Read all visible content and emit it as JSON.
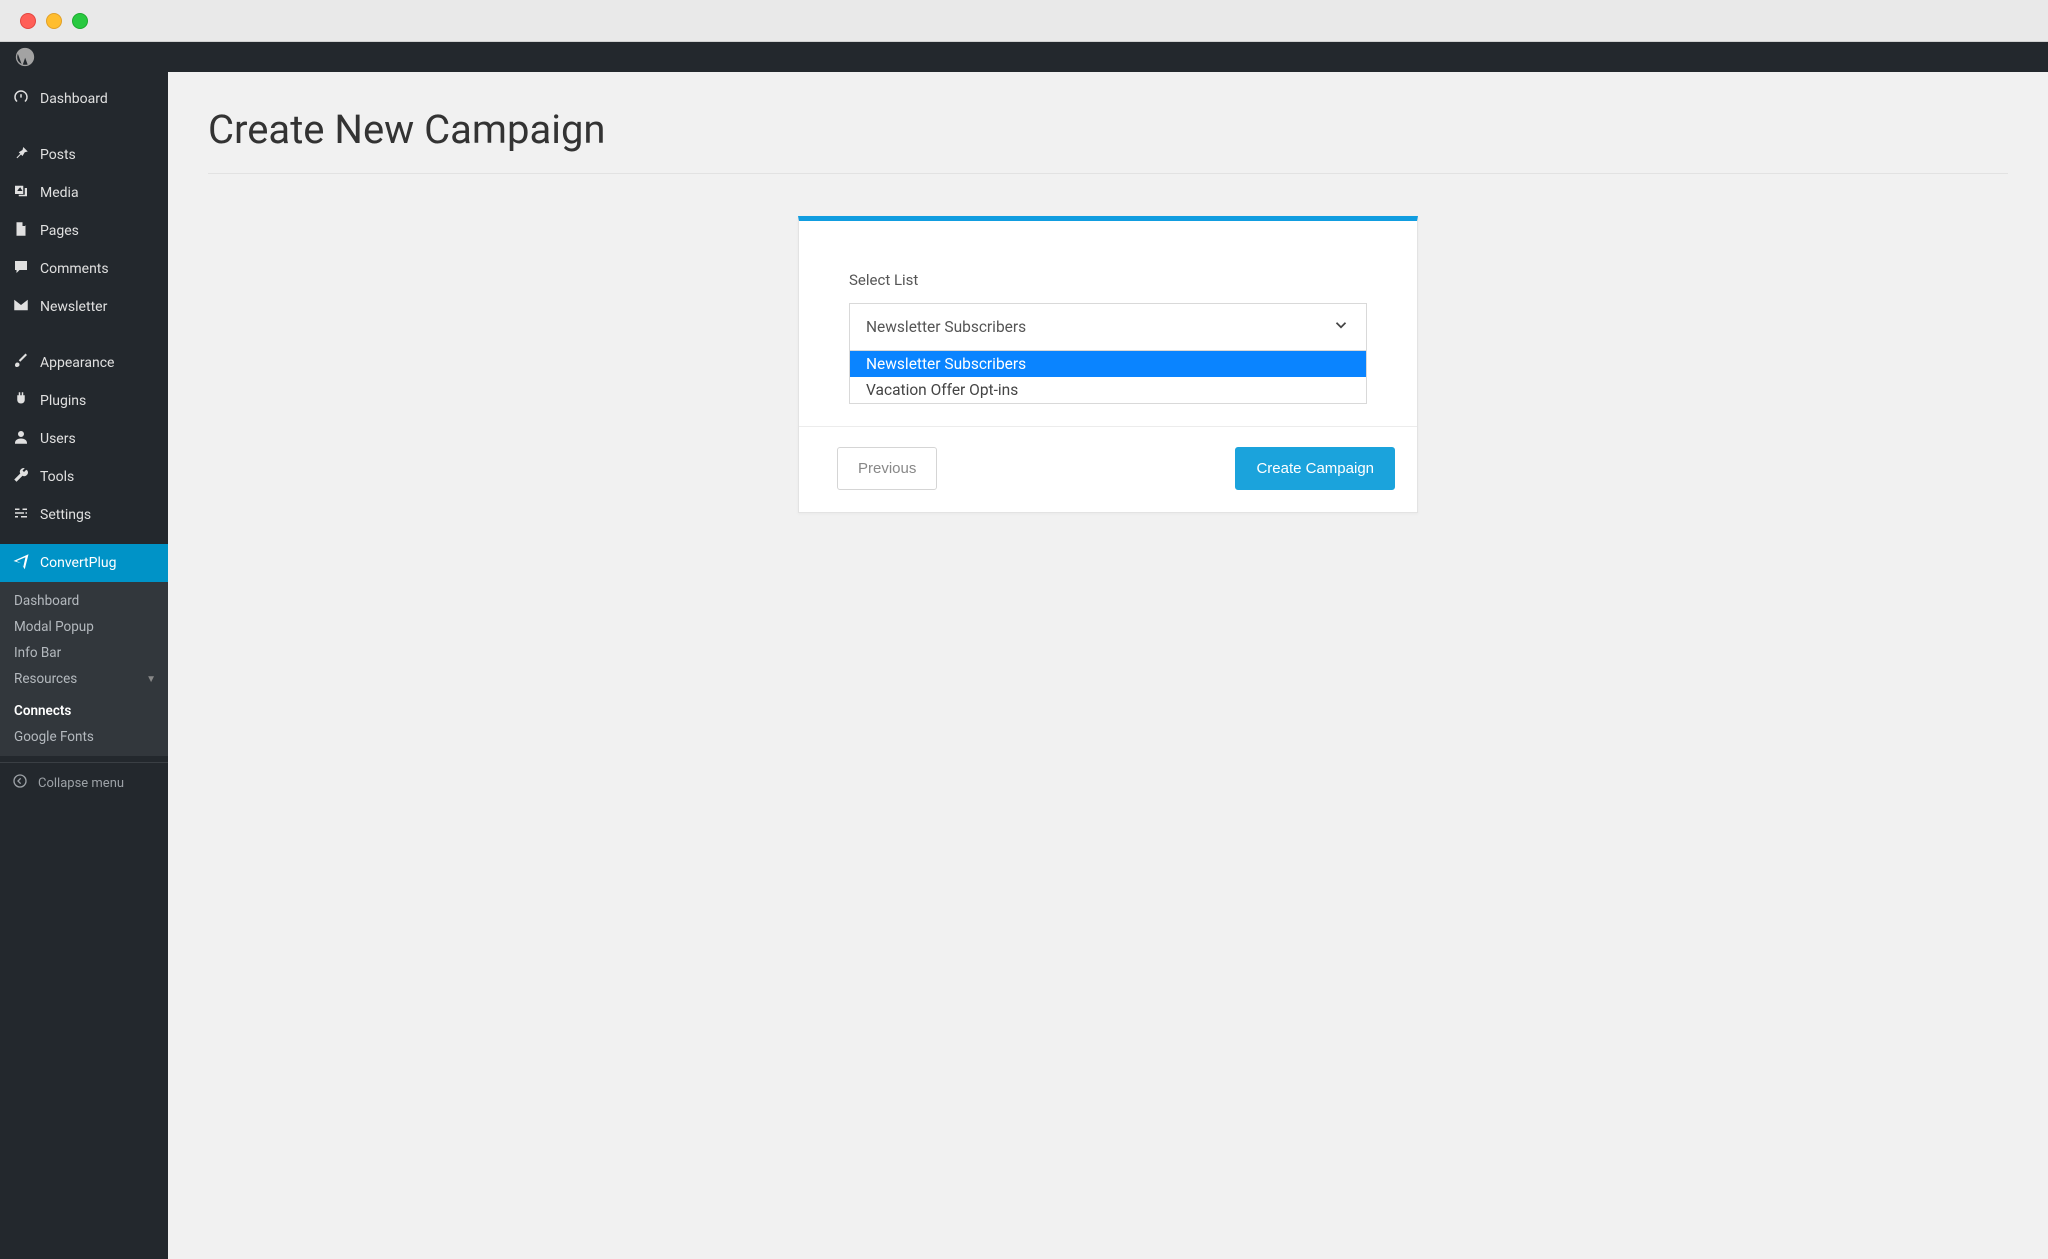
{
  "page": {
    "title": "Create New Campaign"
  },
  "sidebar": {
    "groups": [
      {
        "items": [
          {
            "icon": "dashboard",
            "label": "Dashboard"
          }
        ]
      },
      {
        "items": [
          {
            "icon": "pin",
            "label": "Posts"
          },
          {
            "icon": "media",
            "label": "Media"
          },
          {
            "icon": "page",
            "label": "Pages"
          },
          {
            "icon": "comment",
            "label": "Comments"
          },
          {
            "icon": "mail",
            "label": "Newsletter"
          }
        ]
      },
      {
        "items": [
          {
            "icon": "brush",
            "label": "Appearance"
          },
          {
            "icon": "plug",
            "label": "Plugins"
          },
          {
            "icon": "user",
            "label": "Users"
          },
          {
            "icon": "wrench",
            "label": "Tools"
          },
          {
            "icon": "sliders",
            "label": "Settings"
          }
        ]
      },
      {
        "items": [
          {
            "icon": "send",
            "label": "ConvertPlug",
            "active": true
          }
        ]
      }
    ],
    "submenu": {
      "items": [
        {
          "label": "Dashboard"
        },
        {
          "label": "Modal Popup"
        },
        {
          "label": "Info Bar"
        },
        {
          "label": "Resources",
          "caret": true
        },
        {
          "label": "Connects",
          "bold": true
        },
        {
          "label": "Google Fonts"
        }
      ]
    },
    "collapse_label": "Collapse menu"
  },
  "form": {
    "select_label": "Select List",
    "select_value": "Newsletter Subscribers",
    "options": [
      {
        "label": "Newsletter Subscribers",
        "selected": true
      },
      {
        "label": "Vacation Offer Opt-ins",
        "selected": false
      }
    ],
    "previous_label": "Previous",
    "create_label": "Create Campaign"
  }
}
